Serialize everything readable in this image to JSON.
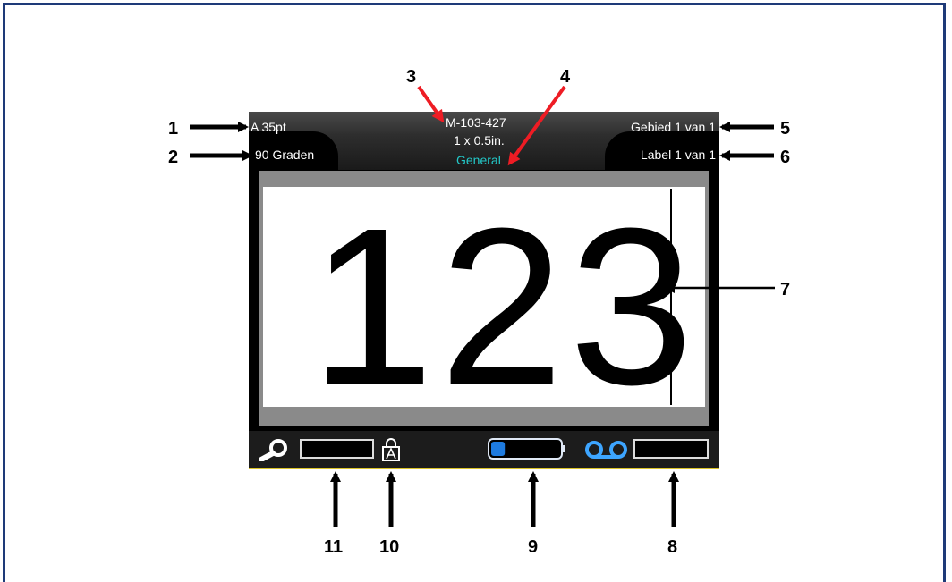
{
  "header": {
    "font_size": "A 35pt",
    "rotation": "90 Graden",
    "part_number": "M-103-427",
    "label_size": "1 x 0.5in.",
    "media_type": "General",
    "area_count": "Gebied 1 van 1",
    "label_count": "Label 1 van 1"
  },
  "editor": {
    "label_text": "123"
  },
  "status_bar": {
    "zoom_icon": "zoom-magnifier-icon",
    "lock_icon": "caps-lock-icon",
    "battery_level": 0.2,
    "tape_icon": "ribbon-cassette-icon"
  },
  "callouts": [
    "1",
    "2",
    "3",
    "4",
    "5",
    "6",
    "7",
    "8",
    "9",
    "10",
    "11"
  ],
  "colors": {
    "frame": "#1e3a78",
    "media_type": "#23c9c9",
    "arrow_red": "#ee1c24",
    "battery_fill": "#1e7be0",
    "status_line": "#d9c229"
  }
}
